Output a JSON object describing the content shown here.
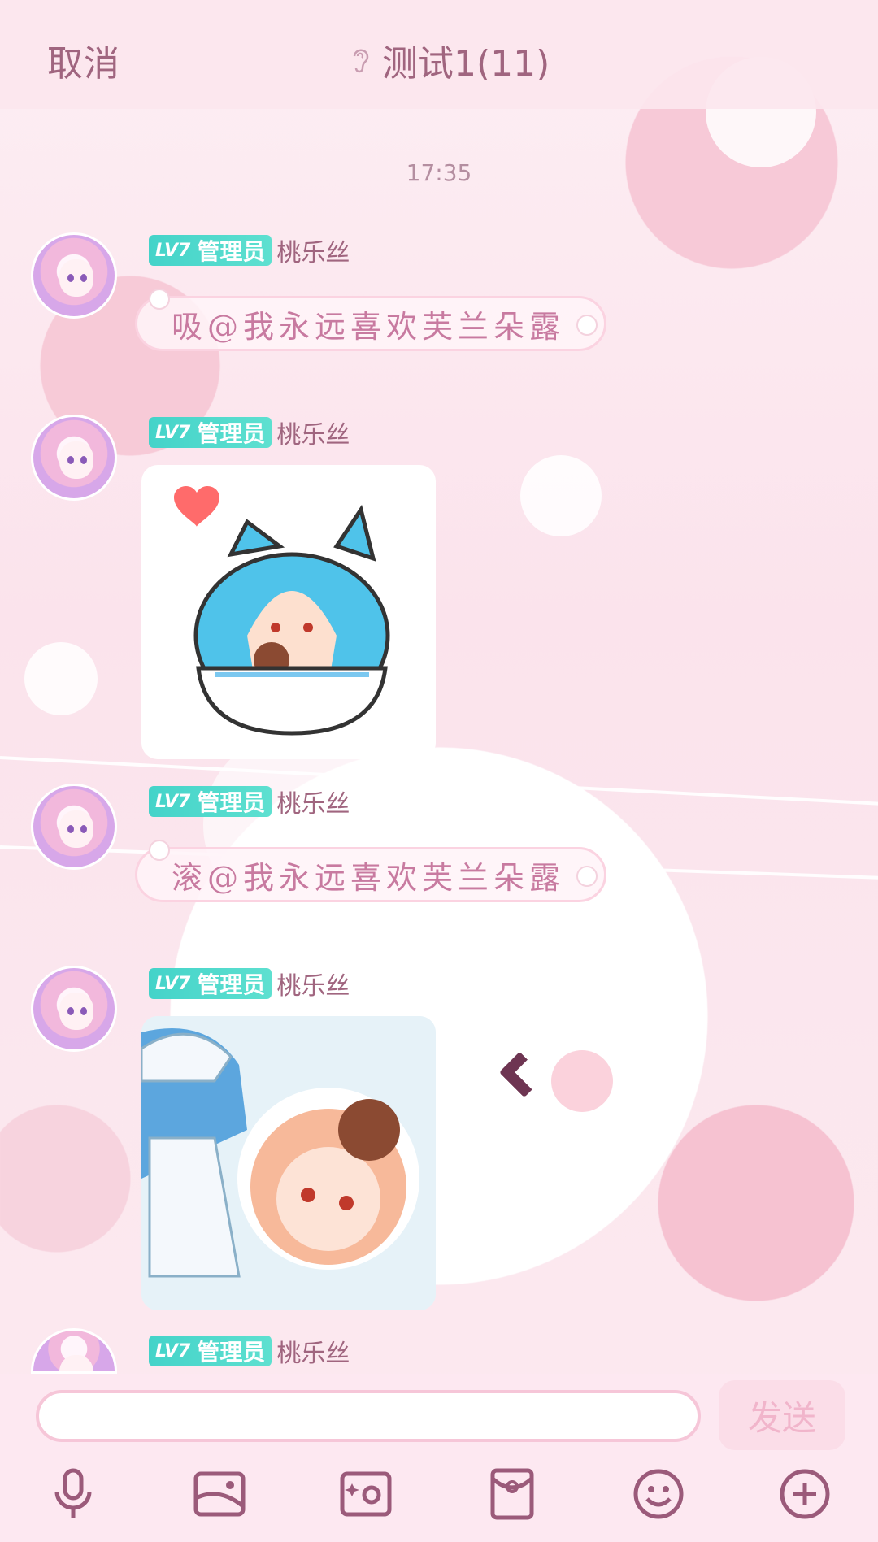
{
  "header": {
    "cancel_label": "取消",
    "title": "测试1(11)"
  },
  "timestamp": "17:35",
  "messages": [
    {
      "level": "LV7",
      "role": "管理员",
      "nickname": "桃乐丝",
      "type": "text",
      "text": "吸@我永远喜欢芙兰朵露"
    },
    {
      "level": "LV7",
      "role": "管理员",
      "nickname": "桃乐丝",
      "type": "image",
      "image": "sticker-blue-cat-cup"
    },
    {
      "level": "LV7",
      "role": "管理员",
      "nickname": "桃乐丝",
      "type": "text",
      "text": "滚@我永远喜欢芙兰朵露"
    },
    {
      "level": "LV7",
      "role": "管理员",
      "nickname": "桃乐丝",
      "type": "image",
      "image": "sticker-anime-girl-circle"
    },
    {
      "level": "LV7",
      "role": "管理员",
      "nickname": "桃乐丝",
      "type": "partial"
    }
  ],
  "input": {
    "placeholder": "",
    "send_label": "发送"
  },
  "toolbar": [
    "mic-icon",
    "image-icon",
    "camera-icon",
    "red-packet-icon",
    "emoji-icon",
    "plus-icon"
  ],
  "colors": {
    "accent_text": "#a0657f",
    "badge_teal": "#44d3c9",
    "bubble_text": "#c87aa0",
    "bubble_border": "#fbd3e1",
    "send_disabled": "#f1b5cb"
  }
}
